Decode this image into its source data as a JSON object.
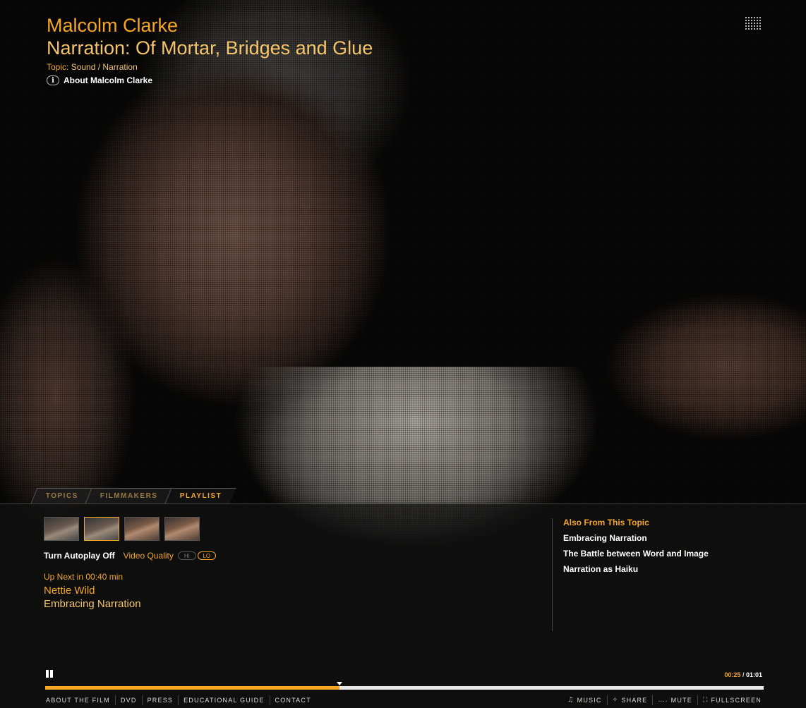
{
  "header": {
    "person": "Malcolm Clarke",
    "title": "Narration: Of Mortar, Bridges and Glue",
    "topic_label": "Topic:",
    "topic_value": "Sound / Narration",
    "about_label": "About Malcolm Clarke",
    "info_icon_glyph": "i"
  },
  "tabs": [
    {
      "label": "TOPICS",
      "active": false
    },
    {
      "label": "FILMMAKERS",
      "active": false
    },
    {
      "label": "PLAYLIST",
      "active": true
    }
  ],
  "playlist": {
    "thumbnails": [
      {
        "icon": "thumbnail-man",
        "selected": false
      },
      {
        "icon": "thumbnail-man",
        "selected": true
      },
      {
        "icon": "thumbnail-woman",
        "selected": false
      },
      {
        "icon": "thumbnail-woman",
        "selected": false
      }
    ],
    "autoplay_label": "Turn Autoplay Off",
    "video_quality_label": "Video Quality",
    "quality_hi": "HI",
    "quality_lo": "LO",
    "selected_quality": "LO",
    "up_next_label": "Up Next in 00:40 min",
    "next_person": "Nettie Wild",
    "next_title": "Embracing Narration"
  },
  "also_from_topic": {
    "heading": "Also From This Topic",
    "items": [
      "Embracing Narration",
      "The Battle between Word and Image",
      "Narration as Haiku"
    ]
  },
  "player": {
    "current_time": "00:25",
    "separator": " / ",
    "duration": "01:01",
    "progress_fraction": 0.41
  },
  "footer": {
    "left": [
      "ABOUT THE FILM",
      "DVD",
      "PRESS",
      "EDUCATIONAL GUIDE",
      "CONTACT"
    ],
    "right": [
      {
        "label": "MUSIC",
        "icon": "music-note-icon",
        "glyph": "♫"
      },
      {
        "label": "SHARE",
        "icon": "share-icon",
        "glyph": "✧"
      },
      {
        "label": "MUTE",
        "icon": "volume-icon",
        "glyph": "…."
      },
      {
        "label": "FULLSCREEN",
        "icon": "fullscreen-icon",
        "glyph": "⛶"
      }
    ]
  },
  "colors": {
    "accent": "#f5a623",
    "accent_light": "#f4c46a"
  }
}
